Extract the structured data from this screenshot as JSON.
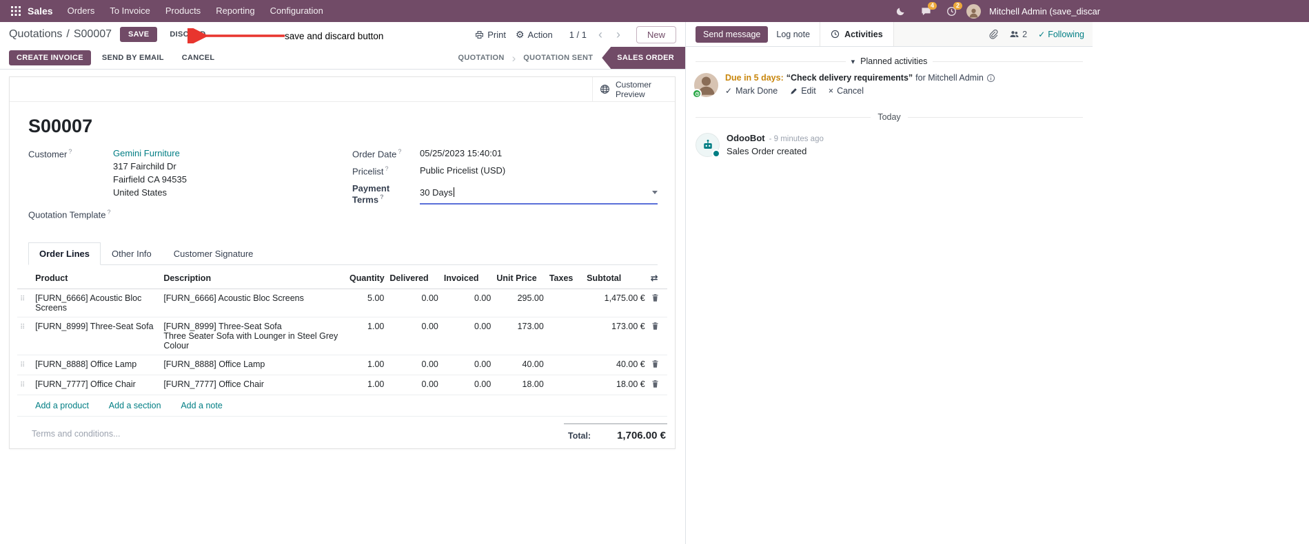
{
  "colors": {
    "brand": "#714B67",
    "link": "#017E84",
    "edited_value": "#2563EB",
    "due_text": "#C9870E",
    "annotation_arrow": "#E8352E",
    "navbar_badge": "#EDA93C",
    "focus_underline": "#5A6FD8"
  },
  "glyphs": {
    "help": "?",
    "slash": "/",
    "prev": "‹",
    "next": "›",
    "chevron": "›",
    "caret_down": "▾",
    "handle": "⠿",
    "check": "✓",
    "times": "×",
    "adjust": "⇄",
    "gear": "⚙"
  },
  "navbar": {
    "app_name": "Sales",
    "menus": [
      "Orders",
      "To Invoice",
      "Products",
      "Reporting",
      "Configuration"
    ],
    "messages_badge": "4",
    "activities_badge": "2",
    "user_name": "Mitchell Admin (save_discar"
  },
  "control_panel": {
    "breadcrumb_parent": "Quotations",
    "breadcrumb_current": "S00007",
    "save": "SAVE",
    "discard": "DISCARD",
    "print": "Print",
    "action": "Action",
    "pager": "1 / 1",
    "new": "New"
  },
  "annotation": {
    "text": "save and discard button"
  },
  "statusbar": {
    "create_invoice": "CREATE INVOICE",
    "send_by_email": "SEND BY EMAIL",
    "cancel": "CANCEL",
    "stages": [
      {
        "label": "QUOTATION"
      },
      {
        "label": "QUOTATION SENT"
      },
      {
        "label": "SALES ORDER"
      }
    ]
  },
  "form": {
    "customer_preview": "Customer Preview",
    "title": "S00007",
    "customer_label": "Customer",
    "customer_value": "Gemini Furniture",
    "address_lines": [
      "317 Fairchild Dr",
      "Fairfield CA 94535",
      "United States"
    ],
    "quotation_template_label": "Quotation Template",
    "order_date_label": "Order Date",
    "order_date_value": "05/25/2023 15:40:01",
    "pricelist_label": "Pricelist",
    "pricelist_value": "Public Pricelist (USD)",
    "payment_terms_label": "Payment Terms",
    "payment_terms_value": "30 Days",
    "tabs": [
      "Order Lines",
      "Other Info",
      "Customer Signature"
    ],
    "columns": [
      "Product",
      "Description",
      "Quantity",
      "Delivered",
      "Invoiced",
      "Unit Price",
      "Taxes",
      "Subtotal"
    ],
    "rows": [
      {
        "product": "[FURN_6666] Acoustic Bloc Screens",
        "description": [
          "[FURN_6666] Acoustic Bloc Screens"
        ],
        "quantity": "5.00",
        "delivered": "0.00",
        "invoiced": "0.00",
        "unit_price": "295.00",
        "taxes": "",
        "subtotal": "1,475.00 €"
      },
      {
        "product": "[FURN_8999] Three-Seat Sofa",
        "description": [
          "[FURN_8999] Three-Seat Sofa",
          "Three Seater Sofa with Lounger in Steel Grey Colour"
        ],
        "quantity": "1.00",
        "delivered": "0.00",
        "invoiced": "0.00",
        "unit_price": "173.00",
        "taxes": "",
        "subtotal": "173.00 €"
      },
      {
        "product": "[FURN_8888] Office Lamp",
        "description": [
          "[FURN_8888] Office Lamp"
        ],
        "quantity": "1.00",
        "delivered": "0.00",
        "invoiced": "0.00",
        "unit_price": "40.00",
        "taxes": "",
        "subtotal": "40.00 €"
      },
      {
        "product": "[FURN_7777] Office Chair",
        "description": [
          "[FURN_7777] Office Chair"
        ],
        "quantity": "1.00",
        "delivered": "0.00",
        "invoiced": "0.00",
        "unit_price": "18.00",
        "taxes": "",
        "subtotal": "18.00 €"
      }
    ],
    "footer_links": [
      "Add a product",
      "Add a section",
      "Add a note"
    ],
    "terms_placeholder": "Terms and conditions...",
    "total_label": "Total:",
    "total_value": "1,706.00 €"
  },
  "chatter": {
    "send_message": "Send message",
    "log_note": "Log note",
    "activities_tab": "Activities",
    "followers_count": "2",
    "following": "Following",
    "planned_header": "Planned activities",
    "activity": {
      "due": "Due in 5 days:",
      "summary": "“Check delivery requirements”",
      "for_user": "for Mitchell Admin",
      "mark_done": "Mark Done",
      "edit": "Edit",
      "cancel": "Cancel"
    },
    "date_divider": "Today",
    "message": {
      "author": "OdooBot",
      "time": "- 9 minutes ago",
      "body": "Sales Order created"
    }
  }
}
